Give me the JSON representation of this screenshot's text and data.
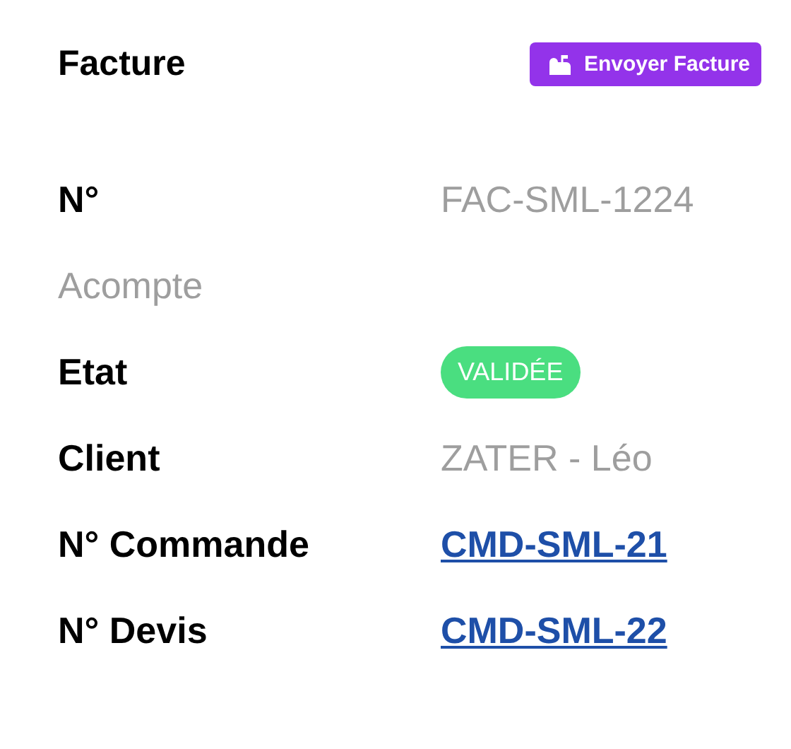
{
  "header": {
    "title": "Facture",
    "action": {
      "label": "Envoyer Facture"
    }
  },
  "fields": [
    {
      "label": "N°",
      "muted": false,
      "value": {
        "kind": "text",
        "text": "FAC-SML-1224"
      }
    },
    {
      "label": "Acompte",
      "muted": true
    },
    {
      "label": "Etat",
      "muted": false,
      "value": {
        "kind": "badge",
        "text": "VALIDÉE",
        "color": "#4ade80"
      }
    },
    {
      "label": "Client",
      "muted": false,
      "value": {
        "kind": "text",
        "text": "ZATER - Léo"
      }
    },
    {
      "label": "N° Commande",
      "muted": false,
      "value": {
        "kind": "link",
        "text": "CMD-SML-21"
      }
    },
    {
      "label": "N° Devis",
      "muted": false,
      "value": {
        "kind": "link",
        "text": "CMD-SML-22"
      }
    }
  ]
}
